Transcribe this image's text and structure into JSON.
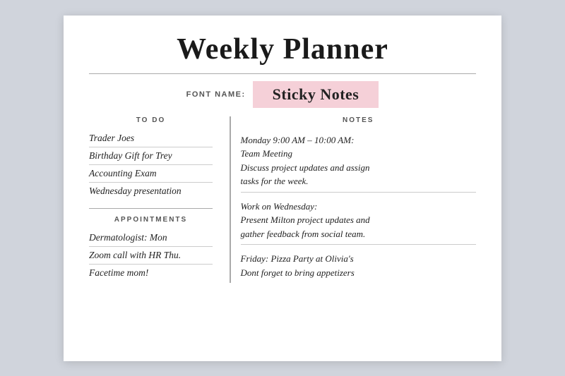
{
  "title": "Weekly Planner",
  "font_name_label": "FONT NAME:",
  "font_name_value": "Sticky Notes",
  "sections": {
    "todo": {
      "header": "TO DO",
      "items": [
        "Trader Joes",
        "Birthday Gift for Trey",
        "Accounting Exam",
        "Wednesday presentation"
      ]
    },
    "appointments": {
      "header": "APPOINTMENTS",
      "items": [
        "Dermatologist: Mon",
        "Zoom call with HR Thu.",
        "Facetime mom!"
      ]
    },
    "notes": {
      "header": "NOTES",
      "blocks": [
        {
          "lines": [
            "Monday 9:00 AM – 10:00 AM:",
            "Team Meeting",
            "Discuss project updates and assign",
            "tasks for the week."
          ]
        },
        {
          "lines": [
            "Work on Wednesday:",
            "Present Milton project updates and",
            "gather feedback from social team."
          ]
        },
        {
          "lines": [
            "Friday: Pizza Party at Olivia's",
            "Dont forget to bring appetizers"
          ]
        }
      ]
    }
  }
}
